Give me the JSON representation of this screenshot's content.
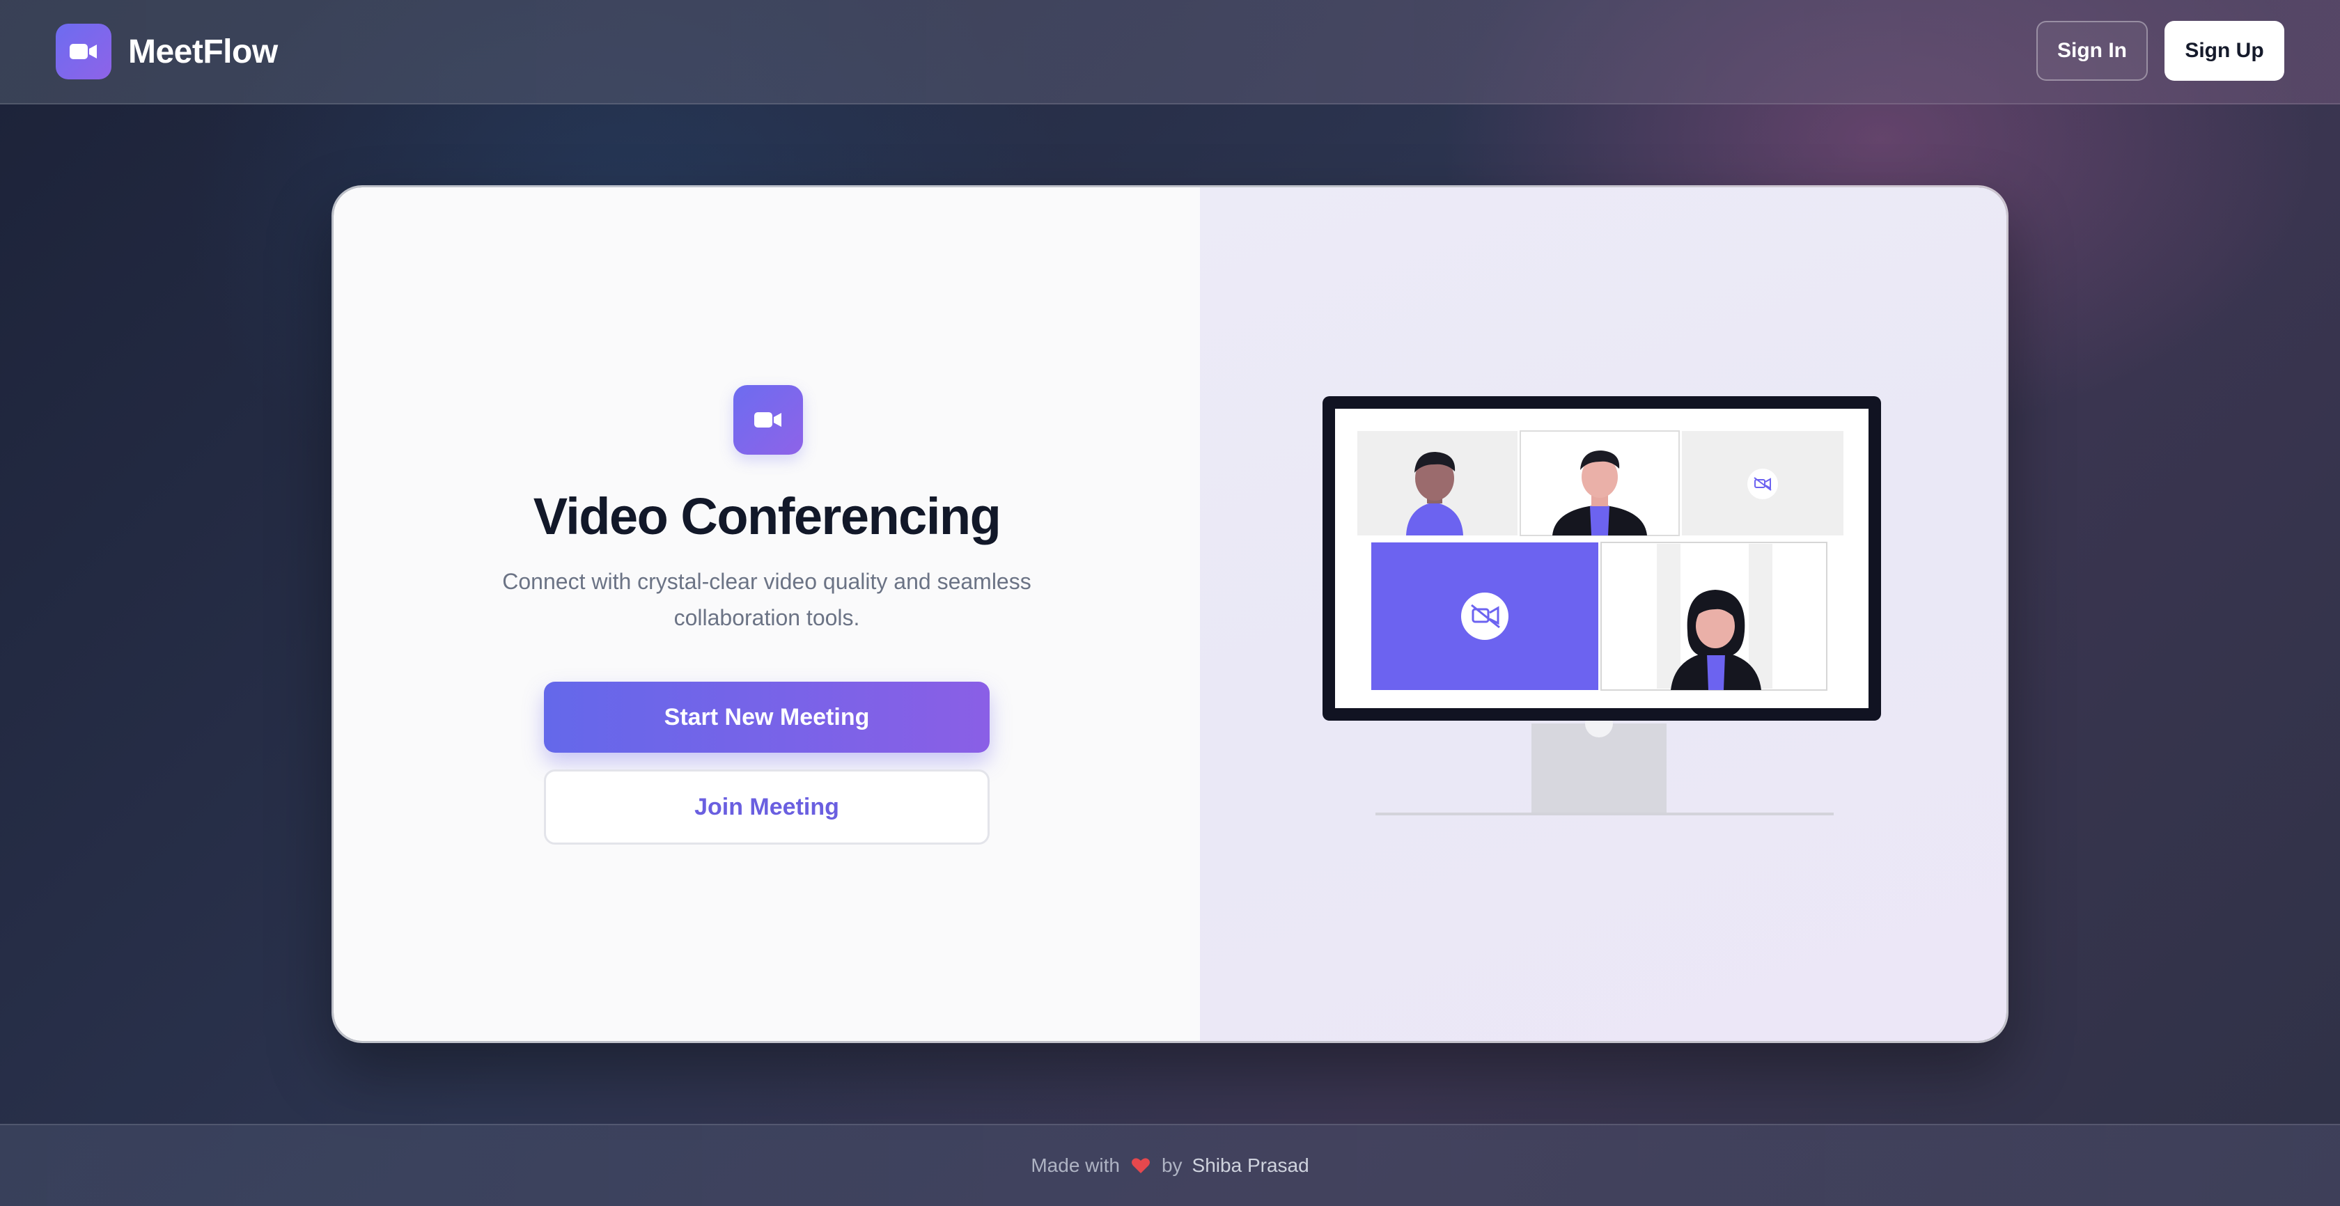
{
  "app": {
    "name": "MeetFlow"
  },
  "header": {
    "sign_in_label": "Sign In",
    "sign_up_label": "Sign Up"
  },
  "hero": {
    "title": "Video Conferencing",
    "subtitle": "Connect with crystal-clear video quality and seamless collaboration tools.",
    "start_label": "Start New Meeting",
    "join_label": "Join Meeting"
  },
  "footer": {
    "made_with": "Made with",
    "by": "by",
    "author": "Shiba Prasad"
  },
  "icons": {
    "brand": "video-camera-icon",
    "hero": "video-camera-icon",
    "heart": "heart-icon",
    "camera_off": "video-off-icon"
  },
  "colors": {
    "accent": "#6d6cf0",
    "accent_end": "#8e63e8",
    "heart": "#e5484d"
  }
}
